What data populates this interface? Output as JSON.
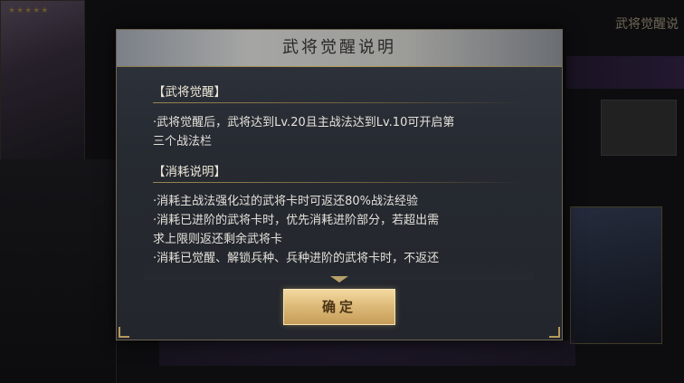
{
  "background": {
    "left_card_stars": "★★★★★",
    "right_title": "武将觉醒说"
  },
  "dialog": {
    "title": "武将觉醒说明",
    "sections": [
      {
        "heading": "【武将觉醒】",
        "lines": [
          "·武将觉醒后，武将达到Lv.20且主战法达到Lv.10可开启第",
          "三个战法栏"
        ]
      },
      {
        "heading": "【消耗说明】",
        "lines": [
          "·消耗主战法强化过的武将卡时可返还80%战法经验",
          "·消耗已进阶的武将卡时，优先消耗进阶部分，若超出需",
          "求上限则返还剩余武将卡",
          "·消耗已觉醒、解锁兵种、兵种进阶的武将卡时，不返还"
        ]
      }
    ],
    "confirm_label": "确定"
  },
  "colors": {
    "accent_gold": "#b79a56",
    "button_gold": "#dcb877",
    "panel_bg": "#262a31"
  }
}
